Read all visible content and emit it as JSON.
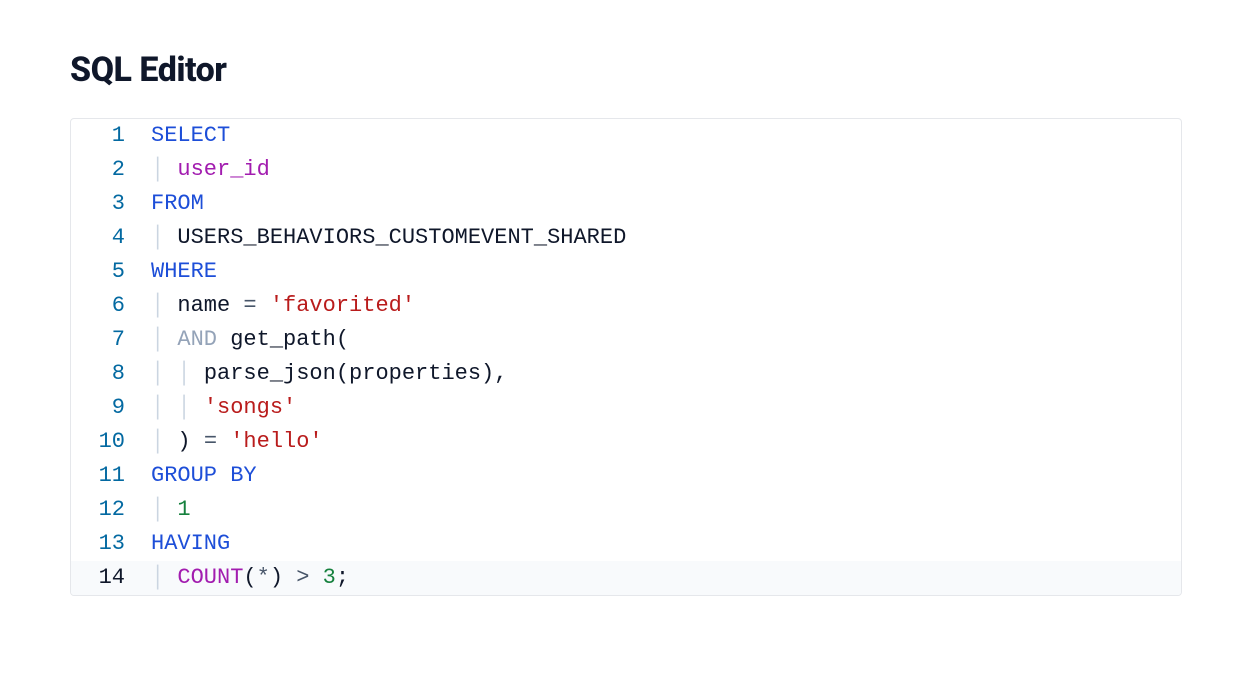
{
  "title": "SQL Editor",
  "highlight_line": 14,
  "lines": [
    {
      "n": "1",
      "tokens": [
        {
          "cls": "kw",
          "t": "SELECT"
        }
      ]
    },
    {
      "n": "2",
      "tokens": [
        {
          "cls": "guide",
          "t": "│ "
        },
        {
          "cls": "id",
          "t": "user_id"
        }
      ]
    },
    {
      "n": "3",
      "tokens": [
        {
          "cls": "kw",
          "t": "FROM"
        }
      ]
    },
    {
      "n": "4",
      "tokens": [
        {
          "cls": "guide",
          "t": "│ "
        },
        {
          "cls": "plain",
          "t": "USERS_BEHAVIORS_CUSTOMEVENT_SHARED"
        }
      ]
    },
    {
      "n": "5",
      "tokens": [
        {
          "cls": "kw",
          "t": "WHERE"
        }
      ]
    },
    {
      "n": "6",
      "tokens": [
        {
          "cls": "guide",
          "t": "│ "
        },
        {
          "cls": "plain",
          "t": "name "
        },
        {
          "cls": "op",
          "t": "="
        },
        {
          "cls": "plain",
          "t": " "
        },
        {
          "cls": "str",
          "t": "'favorited'"
        }
      ]
    },
    {
      "n": "7",
      "tokens": [
        {
          "cls": "guide",
          "t": "│ "
        },
        {
          "cls": "andop",
          "t": "AND"
        },
        {
          "cls": "plain",
          "t": " get_path("
        }
      ]
    },
    {
      "n": "8",
      "tokens": [
        {
          "cls": "guide",
          "t": "│ │ "
        },
        {
          "cls": "plain",
          "t": "parse_json(properties),"
        }
      ]
    },
    {
      "n": "9",
      "tokens": [
        {
          "cls": "guide",
          "t": "│ │ "
        },
        {
          "cls": "str",
          "t": "'songs'"
        }
      ]
    },
    {
      "n": "10",
      "tokens": [
        {
          "cls": "guide",
          "t": "│ "
        },
        {
          "cls": "plain",
          "t": ") "
        },
        {
          "cls": "op",
          "t": "="
        },
        {
          "cls": "plain",
          "t": " "
        },
        {
          "cls": "str",
          "t": "'hello'"
        }
      ]
    },
    {
      "n": "11",
      "tokens": [
        {
          "cls": "kw",
          "t": "GROUP BY"
        }
      ]
    },
    {
      "n": "12",
      "tokens": [
        {
          "cls": "guide",
          "t": "│ "
        },
        {
          "cls": "num",
          "t": "1"
        }
      ]
    },
    {
      "n": "13",
      "tokens": [
        {
          "cls": "kw",
          "t": "HAVING"
        }
      ]
    },
    {
      "n": "14",
      "tokens": [
        {
          "cls": "guide",
          "t": "│ "
        },
        {
          "cls": "id",
          "t": "COUNT"
        },
        {
          "cls": "plain",
          "t": "("
        },
        {
          "cls": "op",
          "t": "*"
        },
        {
          "cls": "plain",
          "t": ") "
        },
        {
          "cls": "op",
          "t": ">"
        },
        {
          "cls": "plain",
          "t": " "
        },
        {
          "cls": "num",
          "t": "3"
        },
        {
          "cls": "plain",
          "t": ";"
        }
      ]
    }
  ]
}
